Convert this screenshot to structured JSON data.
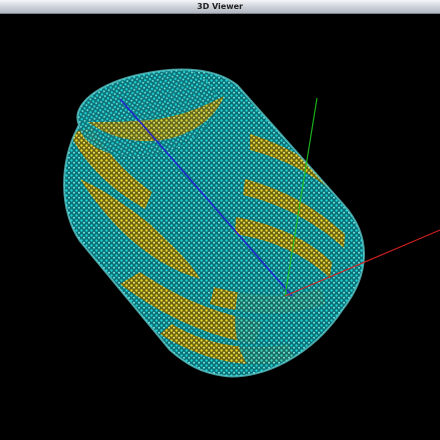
{
  "window": {
    "title": "3D Viewer"
  },
  "viewport": {
    "background": "#000000"
  },
  "point_cloud": {
    "shape": "cylinder",
    "colors": [
      "#17c7c9",
      "#e0d221"
    ]
  },
  "axes": {
    "x_color": "#d81d1d",
    "y_color": "#1dbb1d",
    "z_color": "#2020c8"
  }
}
